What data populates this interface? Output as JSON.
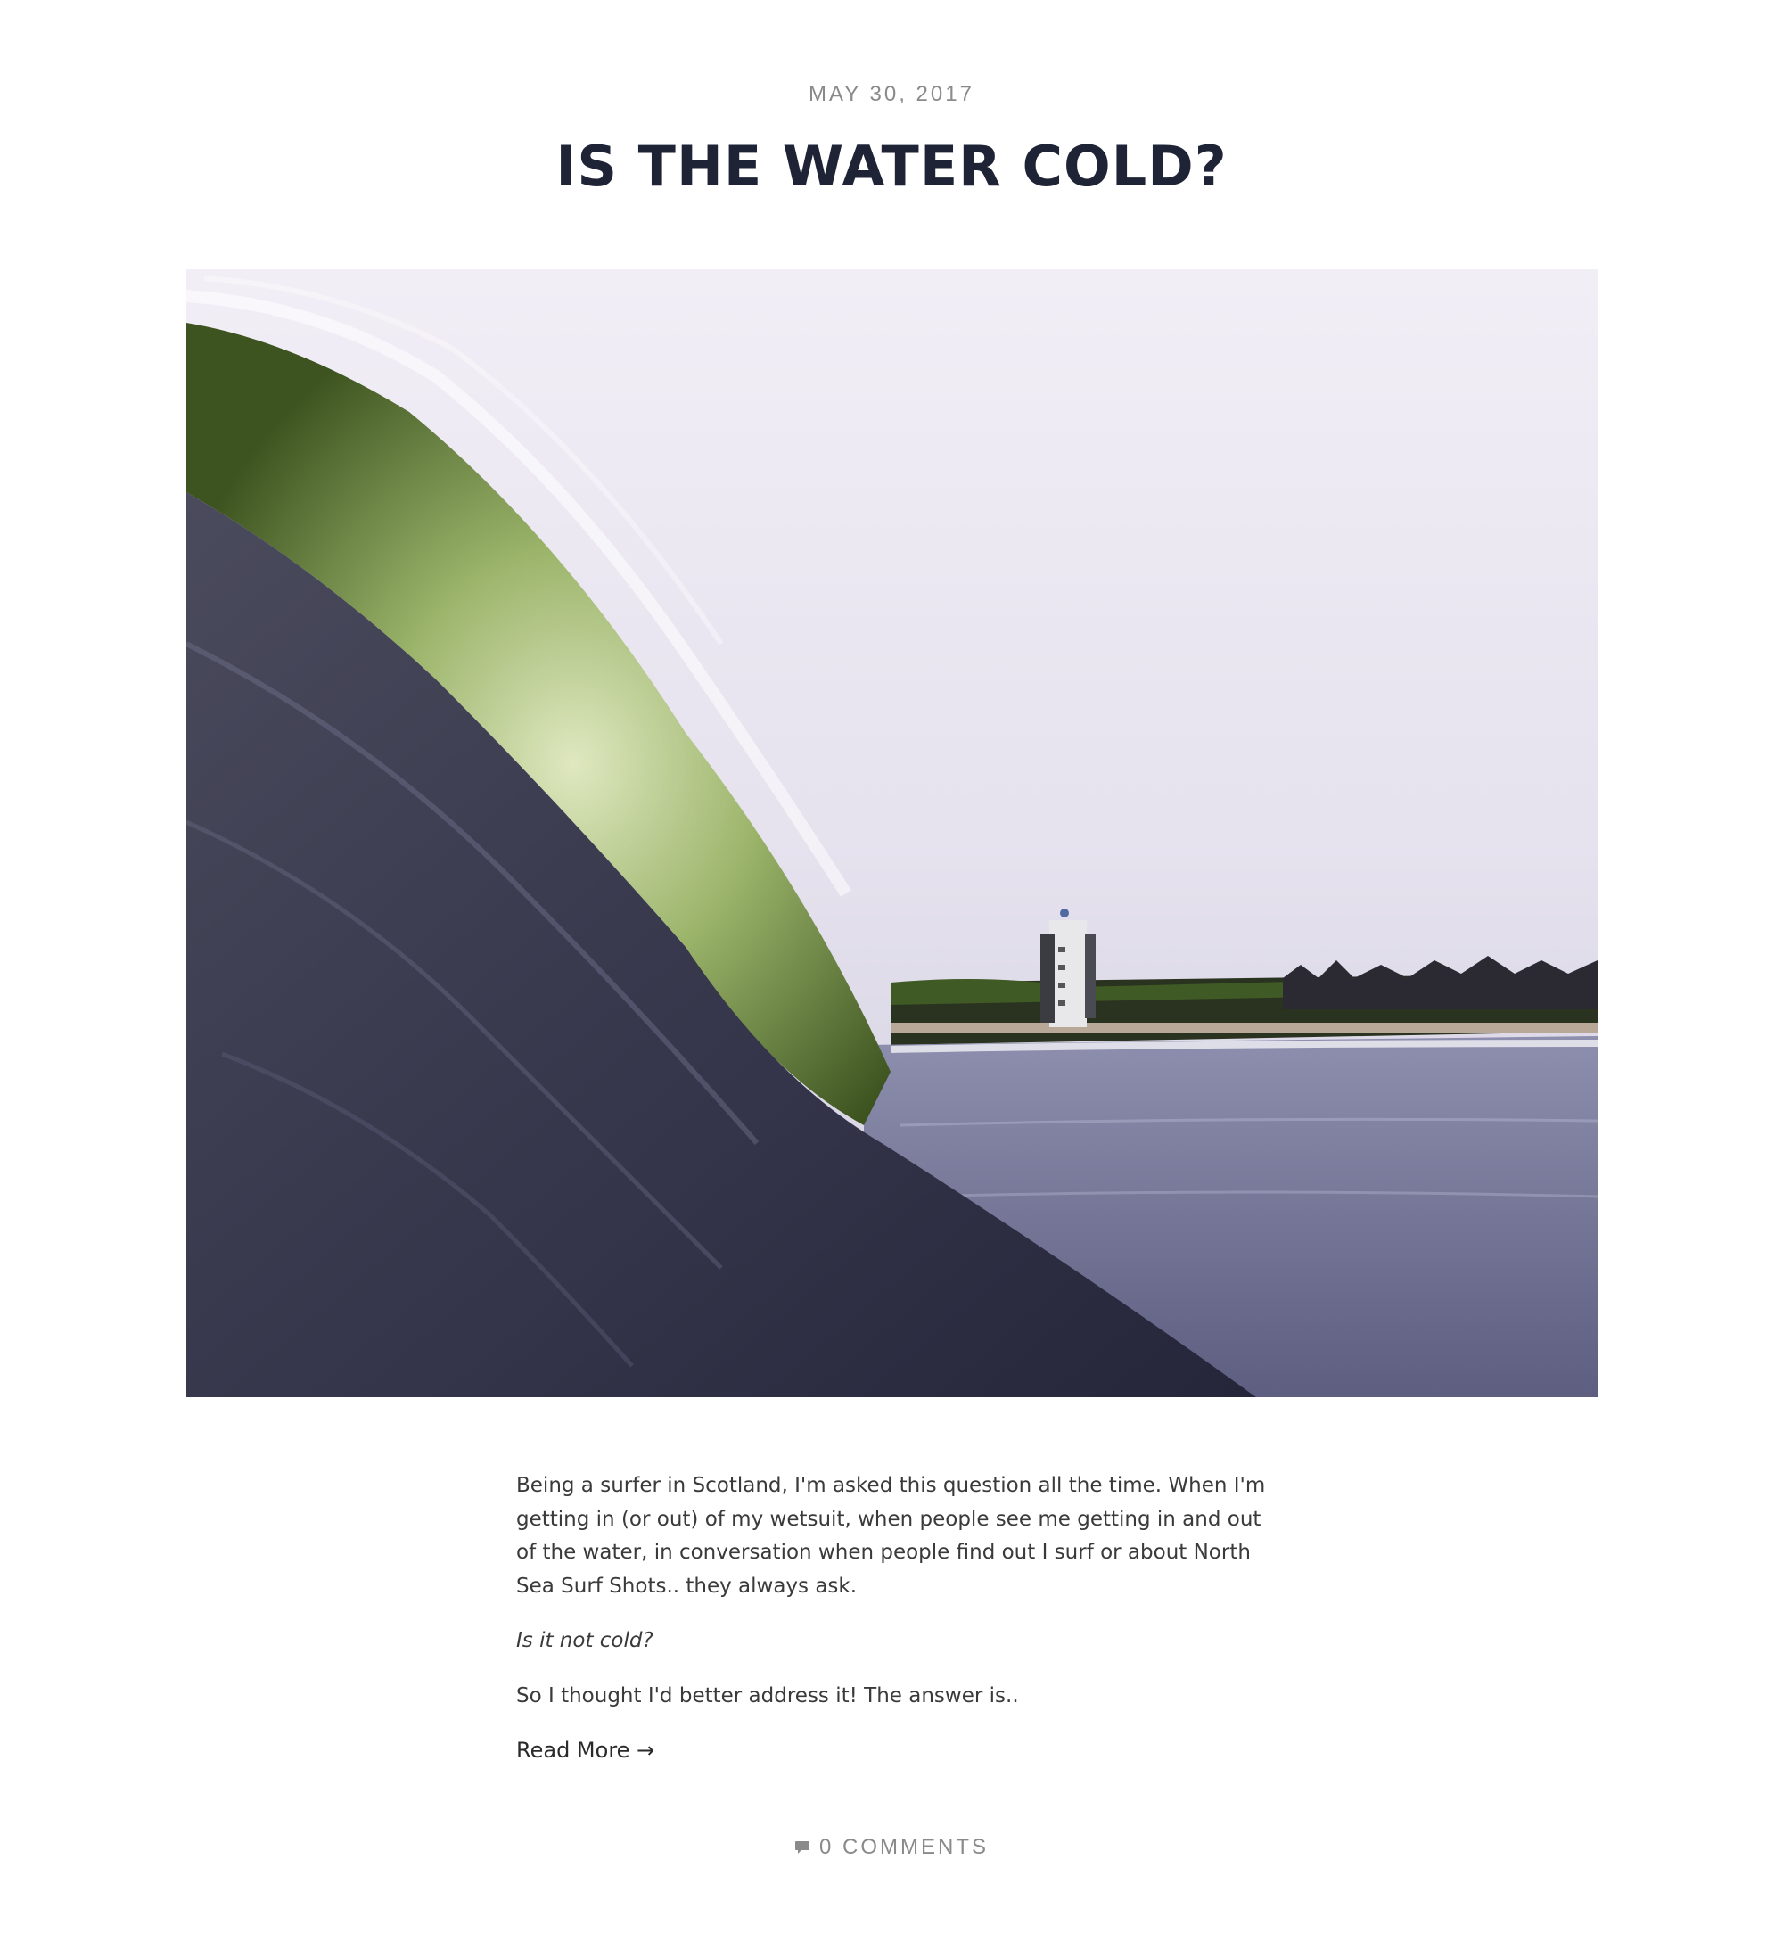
{
  "post": {
    "date": "MAY 30, 2017",
    "title": "IS THE WATER COLD?",
    "featured_image_alt": "Wave breaking with harbour tower in background",
    "paragraphs": [
      "Being a surfer in Scotland, I'm asked this question all the time. When I'm getting in (or out) of my wetsuit, when people see me getting in and out of the water, in conversation when people find out I surf or about North Sea Surf Shots.. they always ask.",
      "Is it not cold?",
      "So I thought I'd better address it! The answer is.."
    ],
    "read_more_label": "Read More →",
    "comments_label": "0 COMMENTS"
  },
  "icons": {
    "comments": "speech-bubble-icon"
  },
  "colors": {
    "title": "#1f2336",
    "meta": "#8a8a8a",
    "body_text": "#3a3a3a"
  }
}
